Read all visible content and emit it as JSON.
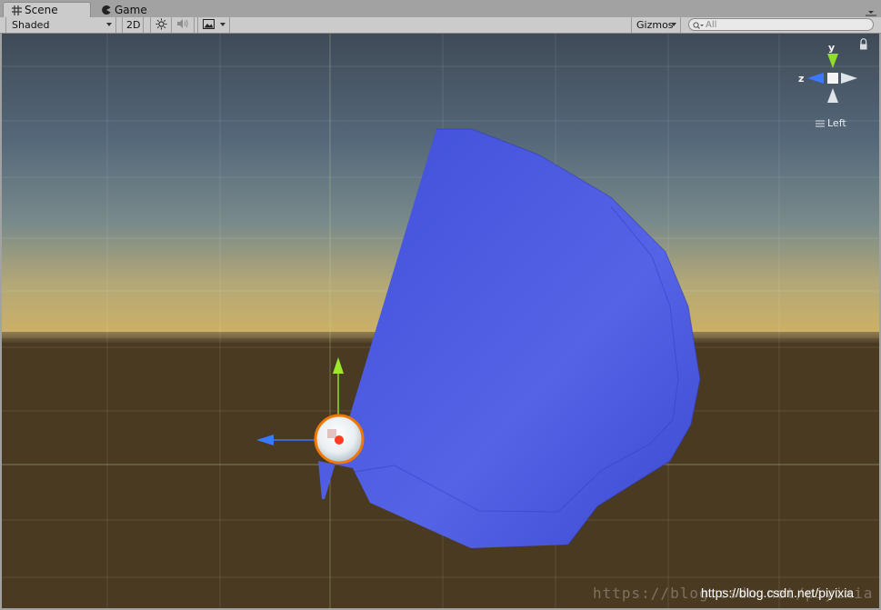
{
  "tabs": [
    {
      "label": "Scene",
      "icon": "grid-icon",
      "active": true
    },
    {
      "label": "Game",
      "icon": "pacman-icon",
      "active": false
    }
  ],
  "toolbar": {
    "shading_mode": "Shaded",
    "mode_2d": "2D",
    "gizmos_label": "Gizmos",
    "search_placeholder": "All"
  },
  "gizmo": {
    "axis_y": "y",
    "axis_z": "z",
    "view_label": "Left"
  },
  "watermark": {
    "faint": "https://blog.csdn.net/piyixia",
    "overlay": "https://blog.csdn.net/piyixia"
  },
  "colors": {
    "trail": "#4a58de",
    "y_axis": "#8fdc2a",
    "z_axis": "#3a78ff",
    "selection": "#f07800",
    "ground": "#4a3a22"
  }
}
